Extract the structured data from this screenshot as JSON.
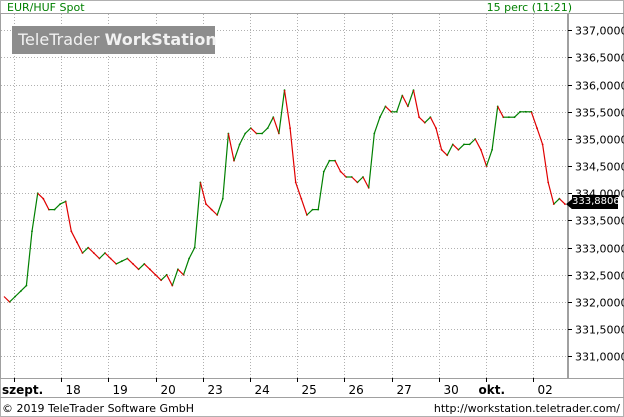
{
  "header": {
    "instrument": "EUR/HUF Spot",
    "timeframe": "15 perc (11:21)"
  },
  "watermark": {
    "part1": "TeleTrader ",
    "part2": "WorkStation"
  },
  "last_price": "333,8806",
  "footer": {
    "copyright": "© 2019 TeleTrader Software GmbH",
    "url": "http://workstation.teletrader.com/"
  },
  "colors": {
    "up": "#008000",
    "down": "#e00000",
    "grid": "#b0b0b0",
    "watermark_bg": "#8d8d8d",
    "header_text": "#008000"
  },
  "chart_data": {
    "type": "line",
    "title": "EUR/HUF Spot",
    "ylim": [
      330.6,
      337.3
    ],
    "y_ticks": [
      "331,0000",
      "331,5000",
      "332,0000",
      "332,5000",
      "333,0000",
      "333,5000",
      "334,0000",
      "334,5000",
      "335,0000",
      "335,5000",
      "336,0000",
      "336,5000",
      "337,0000"
    ],
    "x_labels": [
      "szept.",
      "18",
      "19",
      "20",
      "23",
      "24",
      "25",
      "26",
      "27",
      "30",
      "okt.",
      "02"
    ],
    "grid": true,
    "series": [
      {
        "values": [
          332.1,
          332.0,
          332.1,
          332.2,
          332.3,
          333.3,
          334.0,
          333.9,
          333.7,
          333.7,
          333.8,
          333.85,
          333.3,
          333.1,
          332.9,
          333.0,
          332.9,
          332.8,
          332.9,
          332.8,
          332.7,
          332.75,
          332.8,
          332.7,
          332.6,
          332.7,
          332.6,
          332.5,
          332.4,
          332.5,
          332.3,
          332.6,
          332.5,
          332.8,
          333.0,
          334.2,
          333.8,
          333.7,
          333.6,
          333.9,
          335.1,
          334.6,
          334.9,
          335.1,
          335.2,
          335.1,
          335.1,
          335.2,
          335.4,
          335.1,
          335.9,
          335.2,
          334.2,
          333.9,
          333.6,
          333.7,
          333.7,
          334.4,
          334.6,
          334.6,
          334.4,
          334.3,
          334.3,
          334.2,
          334.3,
          334.1,
          335.1,
          335.4,
          335.6,
          335.5,
          335.5,
          335.8,
          335.6,
          335.9,
          335.4,
          335.3,
          335.4,
          335.2,
          334.8,
          334.7,
          334.9,
          334.8,
          334.9,
          334.9,
          335.0,
          334.8,
          334.5,
          334.8,
          335.6,
          335.4,
          335.4,
          335.4,
          335.5,
          335.5,
          335.5,
          335.2,
          334.9,
          334.2,
          333.8,
          333.9,
          333.8
        ]
      }
    ]
  }
}
